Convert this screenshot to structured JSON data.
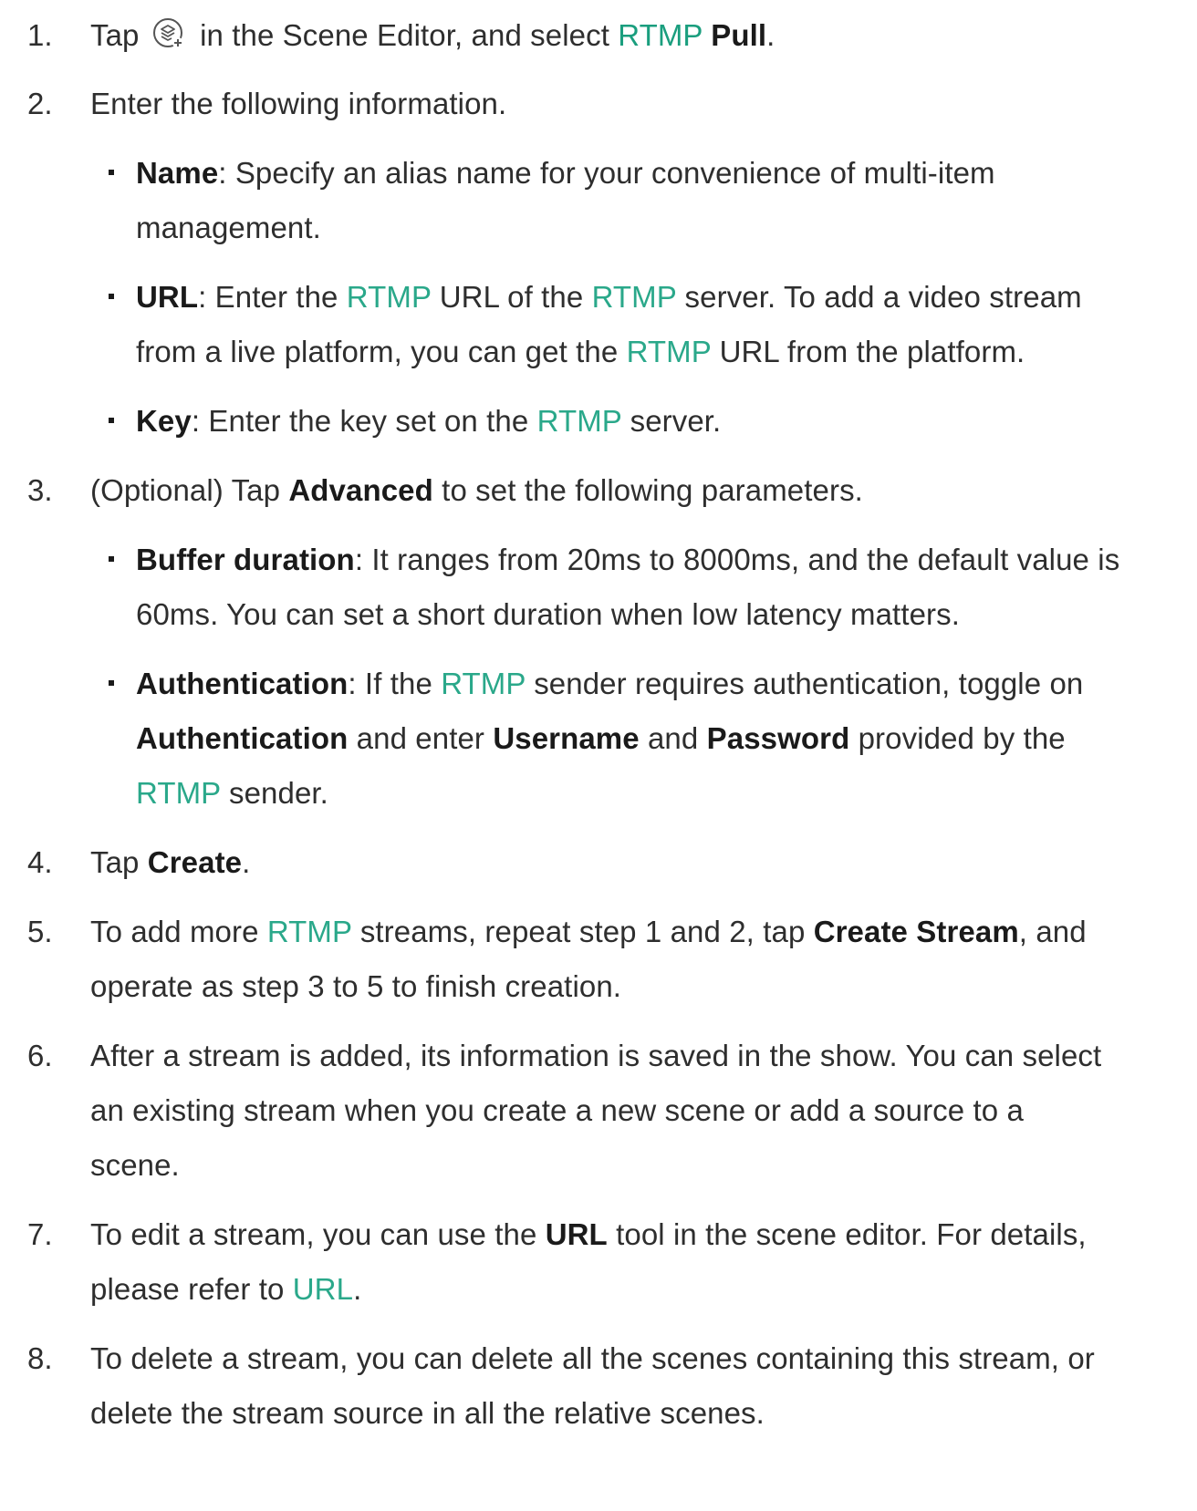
{
  "steps": [
    {
      "number": "1."
    },
    {
      "number": "2.",
      "text": "Enter the following information."
    },
    {
      "number": "3."
    },
    {
      "number": "4."
    },
    {
      "number": "5."
    },
    {
      "number": "6."
    },
    {
      "number": "7."
    },
    {
      "number": "8."
    }
  ],
  "s1": {
    "tap": "Tap",
    "after_icon": "in the Scene Editor, and select",
    "rtmp": "RTMP",
    "pull": "Pull",
    "end": "."
  },
  "s2": {
    "name": {
      "label": "Name",
      "text1": ": Specify an alias name for your convenience of multi-item",
      "text2": "management."
    },
    "url": {
      "label": "URL",
      "a": ": Enter the",
      "r1": "RTMP",
      "b": "URL of the",
      "r2": "RTMP",
      "c": "server. To add a video stream",
      "d": "from a live platform, you can get the",
      "r3": "RTMP",
      "e": "URL from the platform."
    },
    "key": {
      "label": "Key",
      "a": ": Enter the key set on the",
      "r": "RTMP",
      "b": "server."
    }
  },
  "s3": {
    "a": "(Optional) Tap",
    "advanced": "Advanced",
    "b": "to set the following parameters.",
    "buffer": {
      "label": "Buffer duration",
      "text1": ": It ranges from 20ms to 8000ms, and the default value is",
      "text2": "60ms. You can set a short duration when low latency matters."
    },
    "auth": {
      "label": "Authentication",
      "a": ": If the",
      "r1": "RTMP",
      "b": "sender requires authentication, toggle on",
      "auth2": "Authentication",
      "c": "and enter",
      "username": "Username",
      "d": "and",
      "password": "Password",
      "e": "provided by the",
      "r2": "RTMP",
      "f": "sender."
    }
  },
  "s4": {
    "a": "Tap",
    "create": "Create",
    "end": "."
  },
  "s5": {
    "a": "To add more",
    "r": "RTMP",
    "b": "streams, repeat step 1 and 2, tap",
    "cs": "Create Stream",
    "c": ", and",
    "line2": "operate as step 3 to 5 to finish creation."
  },
  "s6": {
    "line1": "After a stream is added, its information is saved in the show. You can select",
    "line2": "an existing stream when you create a new scene or add a source to a",
    "line3": "scene."
  },
  "s7": {
    "a": "To edit a stream, you can use the",
    "url": "URL",
    "b": "tool in the scene editor. For details,",
    "c": "please refer to",
    "link": "URL",
    "end": "."
  },
  "s8": {
    "line1": "To delete a stream, you can delete all the scenes containing this stream, or",
    "line2": "delete the stream source in all the relative scenes."
  },
  "icons": {
    "add_source": "layers-add-icon"
  },
  "colors": {
    "accent": "#2aa88a",
    "text": "#2e2e2e"
  }
}
